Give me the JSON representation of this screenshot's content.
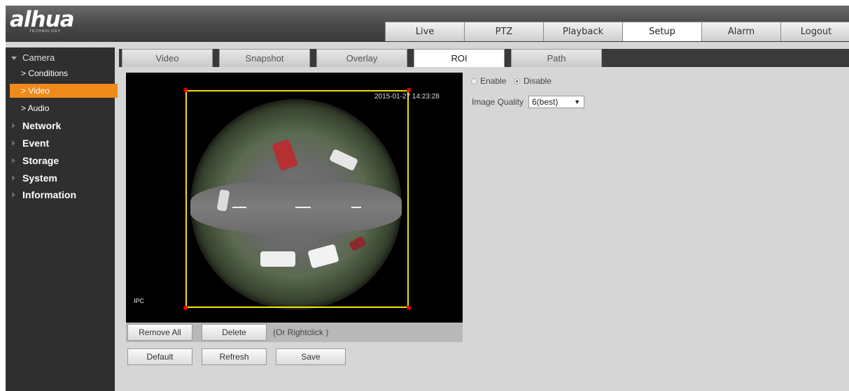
{
  "brand": {
    "logo": "alhua",
    "subtitle": "TECHNOLOGY"
  },
  "nav": {
    "tabs": [
      {
        "label": "Live"
      },
      {
        "label": "PTZ"
      },
      {
        "label": "Playback"
      },
      {
        "label": "Setup",
        "active": true
      },
      {
        "label": "Alarm"
      },
      {
        "label": "Logout"
      }
    ]
  },
  "help_glyph": "?",
  "sidebar": {
    "items": [
      {
        "label": "Camera",
        "type": "main",
        "open": true
      },
      {
        "label": "> Conditions",
        "type": "sub"
      },
      {
        "label": "> Video",
        "type": "sub",
        "active": true
      },
      {
        "label": "> Audio",
        "type": "sub"
      },
      {
        "label": "Network",
        "type": "main"
      },
      {
        "label": "Event",
        "type": "main"
      },
      {
        "label": "Storage",
        "type": "main"
      },
      {
        "label": "System",
        "type": "main"
      },
      {
        "label": "Information",
        "type": "main"
      }
    ]
  },
  "subtabs": [
    {
      "label": "Video"
    },
    {
      "label": "Snapshot"
    },
    {
      "label": "Overlay"
    },
    {
      "label": "ROI",
      "active": true
    },
    {
      "label": "Path"
    }
  ],
  "video": {
    "timestamp": "2015-01-27 14:23:28",
    "channel_label": "IPC"
  },
  "roi_buttons": {
    "remove_all": "Remove All",
    "delete": "Delete",
    "hint": "(Or Rightclick )"
  },
  "settings": {
    "enable_label": "Enable",
    "disable_label": "Disable",
    "selected": "Disable",
    "image_quality_label": "Image Quality",
    "image_quality_value": "6(best)"
  },
  "footer_buttons": {
    "default": "Default",
    "refresh": "Refresh",
    "save": "Save"
  },
  "colors": {
    "active_menu": "#f08a1a",
    "roi_rect": "#f5e000",
    "roi_handle": "#e00000"
  }
}
